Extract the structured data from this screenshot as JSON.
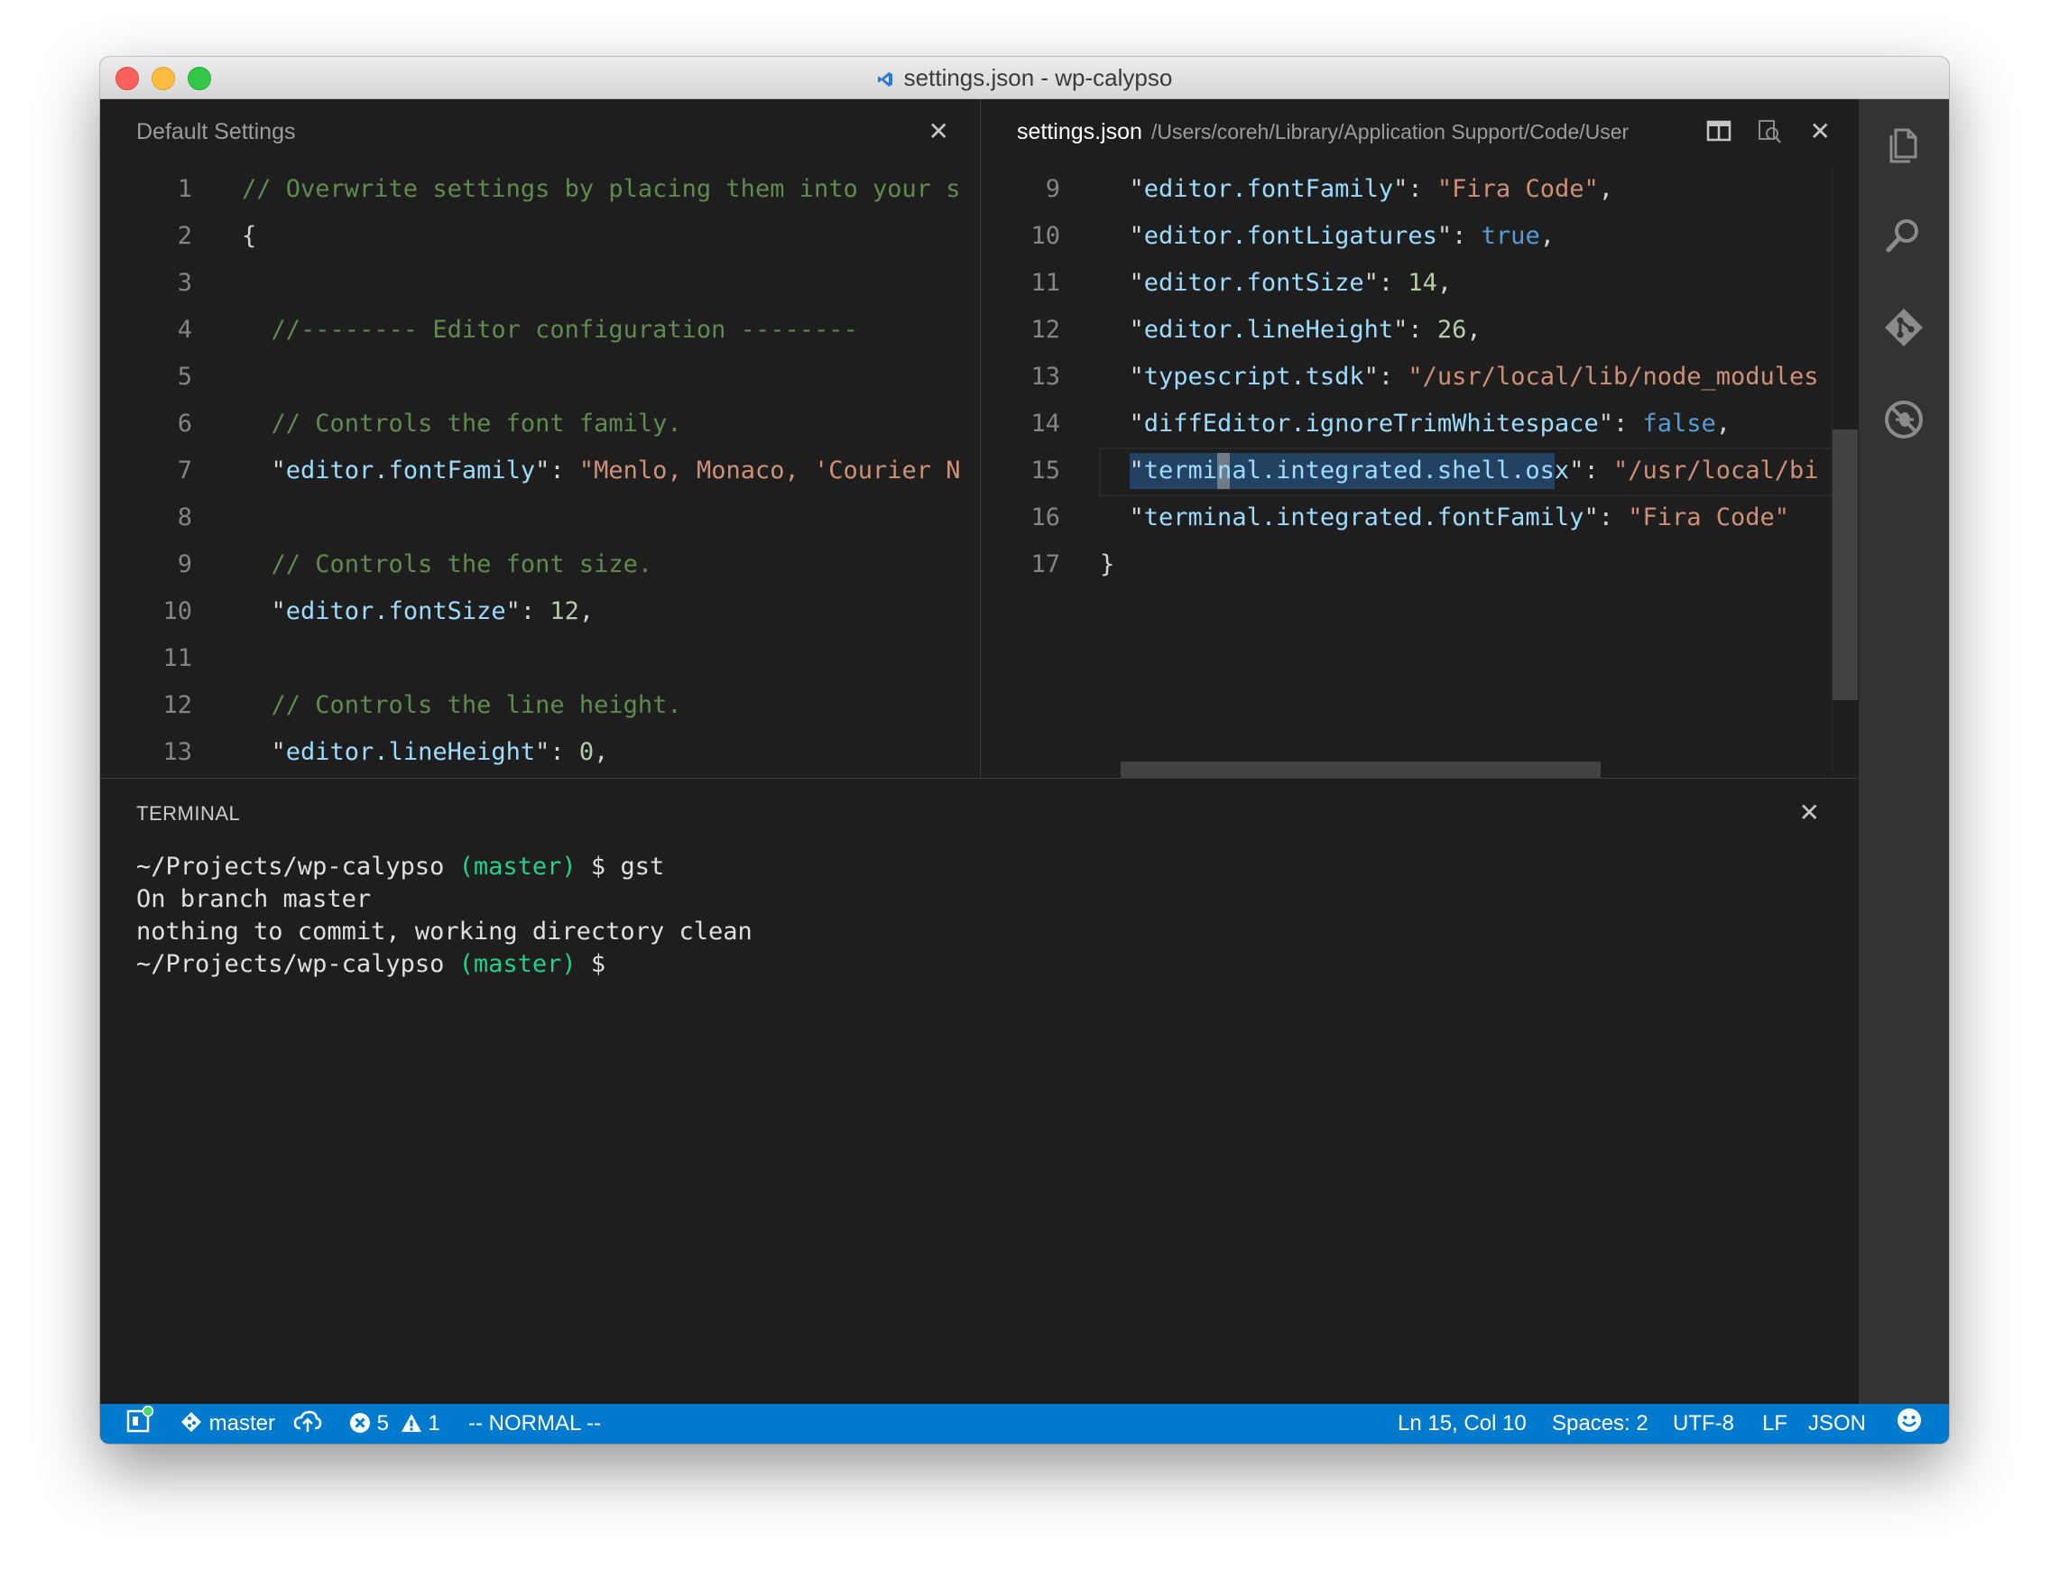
{
  "window": {
    "title": "settings.json - wp-calypso"
  },
  "left_pane": {
    "title": "Default Settings",
    "lines": [
      {
        "n": "1",
        "tokens": [
          {
            "t": "// Overwrite settings by placing them into your s",
            "c": "c-com"
          }
        ]
      },
      {
        "n": "2",
        "tokens": [
          {
            "t": "{",
            "c": "c-pun"
          }
        ]
      },
      {
        "n": "3",
        "tokens": []
      },
      {
        "n": "4",
        "tokens": [
          {
            "t": "  //-------- Editor configuration --------",
            "c": "c-com"
          }
        ]
      },
      {
        "n": "5",
        "tokens": []
      },
      {
        "n": "6",
        "tokens": [
          {
            "t": "  // Controls the font family.",
            "c": "c-com"
          }
        ]
      },
      {
        "n": "7",
        "tokens": [
          {
            "t": "  \"",
            "c": "c-pun"
          },
          {
            "t": "editor.fontFamily",
            "c": "c-key"
          },
          {
            "t": "\": ",
            "c": "c-pun"
          },
          {
            "t": "\"Menlo, Monaco, 'Courier N",
            "c": "c-str"
          }
        ]
      },
      {
        "n": "8",
        "tokens": []
      },
      {
        "n": "9",
        "tokens": [
          {
            "t": "  // Controls the font size.",
            "c": "c-com"
          }
        ]
      },
      {
        "n": "10",
        "tokens": [
          {
            "t": "  \"",
            "c": "c-pun"
          },
          {
            "t": "editor.fontSize",
            "c": "c-key"
          },
          {
            "t": "\": ",
            "c": "c-pun"
          },
          {
            "t": "12",
            "c": "c-num"
          },
          {
            "t": ",",
            "c": "c-pun"
          }
        ]
      },
      {
        "n": "11",
        "tokens": []
      },
      {
        "n": "12",
        "tokens": [
          {
            "t": "  // Controls the line height.",
            "c": "c-com"
          }
        ]
      },
      {
        "n": "13",
        "tokens": [
          {
            "t": "  \"",
            "c": "c-pun"
          },
          {
            "t": "editor.lineHeight",
            "c": "c-key"
          },
          {
            "t": "\": ",
            "c": "c-pun"
          },
          {
            "t": "0",
            "c": "c-num"
          },
          {
            "t": ",",
            "c": "c-pun"
          }
        ]
      }
    ]
  },
  "right_pane": {
    "title": "settings.json",
    "path": "/Users/coreh/Library/Application Support/Code/User",
    "lines": [
      {
        "n": "9",
        "tokens": [
          {
            "t": "  \"",
            "c": "c-pun"
          },
          {
            "t": "editor.fontFamily",
            "c": "c-key"
          },
          {
            "t": "\": ",
            "c": "c-pun"
          },
          {
            "t": "\"Fira Code\"",
            "c": "c-str"
          },
          {
            "t": ",",
            "c": "c-pun"
          }
        ]
      },
      {
        "n": "10",
        "tokens": [
          {
            "t": "  \"",
            "c": "c-pun"
          },
          {
            "t": "editor.fontLigatures",
            "c": "c-key"
          },
          {
            "t": "\": ",
            "c": "c-pun"
          },
          {
            "t": "true",
            "c": "c-bool"
          },
          {
            "t": ",",
            "c": "c-pun"
          }
        ]
      },
      {
        "n": "11",
        "tokens": [
          {
            "t": "  \"",
            "c": "c-pun"
          },
          {
            "t": "editor.fontSize",
            "c": "c-key"
          },
          {
            "t": "\": ",
            "c": "c-pun"
          },
          {
            "t": "14",
            "c": "c-num"
          },
          {
            "t": ",",
            "c": "c-pun"
          }
        ]
      },
      {
        "n": "12",
        "tokens": [
          {
            "t": "  \"",
            "c": "c-pun"
          },
          {
            "t": "editor.lineHeight",
            "c": "c-key"
          },
          {
            "t": "\": ",
            "c": "c-pun"
          },
          {
            "t": "26",
            "c": "c-num"
          },
          {
            "t": ",",
            "c": "c-pun"
          }
        ]
      },
      {
        "n": "13",
        "tokens": [
          {
            "t": "  \"",
            "c": "c-pun"
          },
          {
            "t": "typescript.tsdk",
            "c": "c-key"
          },
          {
            "t": "\": ",
            "c": "c-pun"
          },
          {
            "t": "\"/usr/local/lib/node_modules",
            "c": "c-str"
          }
        ]
      },
      {
        "n": "14",
        "tokens": [
          {
            "t": "  \"",
            "c": "c-pun"
          },
          {
            "t": "diffEditor.ignoreTrimWhitespace",
            "c": "c-key"
          },
          {
            "t": "\": ",
            "c": "c-pun"
          },
          {
            "t": "false",
            "c": "c-bool"
          },
          {
            "t": ",",
            "c": "c-pun"
          }
        ]
      },
      {
        "n": "15",
        "tokens": [
          {
            "t": "  \"",
            "c": "c-pun"
          },
          {
            "t": "terminal.integrated.shell.osx",
            "c": "c-key"
          },
          {
            "t": "\": ",
            "c": "c-pun"
          },
          {
            "t": "\"/usr/local/bi",
            "c": "c-str"
          }
        ],
        "current": true
      },
      {
        "n": "16",
        "tokens": [
          {
            "t": "  \"",
            "c": "c-pun"
          },
          {
            "t": "terminal.integrated.fontFamily",
            "c": "c-key"
          },
          {
            "t": "\": ",
            "c": "c-pun"
          },
          {
            "t": "\"Fira Code\"",
            "c": "c-str"
          }
        ]
      },
      {
        "n": "17",
        "tokens": [
          {
            "t": "}",
            "c": "c-pun"
          }
        ]
      }
    ]
  },
  "terminal": {
    "title": "TERMINAL",
    "lines": [
      [
        {
          "t": "~/Projects/wp-calypso ",
          "c": ""
        },
        {
          "t": "(master)",
          "c": "t-green"
        },
        {
          "t": " $ gst",
          "c": ""
        }
      ],
      [
        {
          "t": "On branch master",
          "c": ""
        }
      ],
      [
        {
          "t": "nothing to commit, working directory clean",
          "c": ""
        }
      ],
      [
        {
          "t": "~/Projects/wp-calypso ",
          "c": ""
        },
        {
          "t": "(master)",
          "c": "t-green"
        },
        {
          "t": " $",
          "c": ""
        }
      ]
    ]
  },
  "status_bar": {
    "branch": "master",
    "errors": "5",
    "warnings": "1",
    "vim_mode": "-- NORMAL --",
    "position": "Ln 15, Col 10",
    "indent": "Spaces: 2",
    "encoding": "UTF-8",
    "eol": "LF",
    "language": "JSON"
  },
  "colors": {
    "statusbar": "#007acc",
    "activitybar": "#333333",
    "editor_bg": "#1e1e1e",
    "comment": "#608b4e",
    "key": "#9cdcfe",
    "string": "#ce9178",
    "number": "#b5cea8",
    "keyword": "#569cd6",
    "terminal_branch": "#23d18b"
  },
  "icons": {
    "activity": [
      "files-icon",
      "search-icon",
      "git-icon",
      "debug-icon"
    ],
    "pane_actions": [
      "split-editor-icon",
      "open-changes-icon",
      "close-icon"
    ],
    "status": [
      "feedback-icon",
      "branch-icon",
      "sync-icon",
      "error-icon",
      "warning-icon",
      "smiley-icon"
    ]
  }
}
